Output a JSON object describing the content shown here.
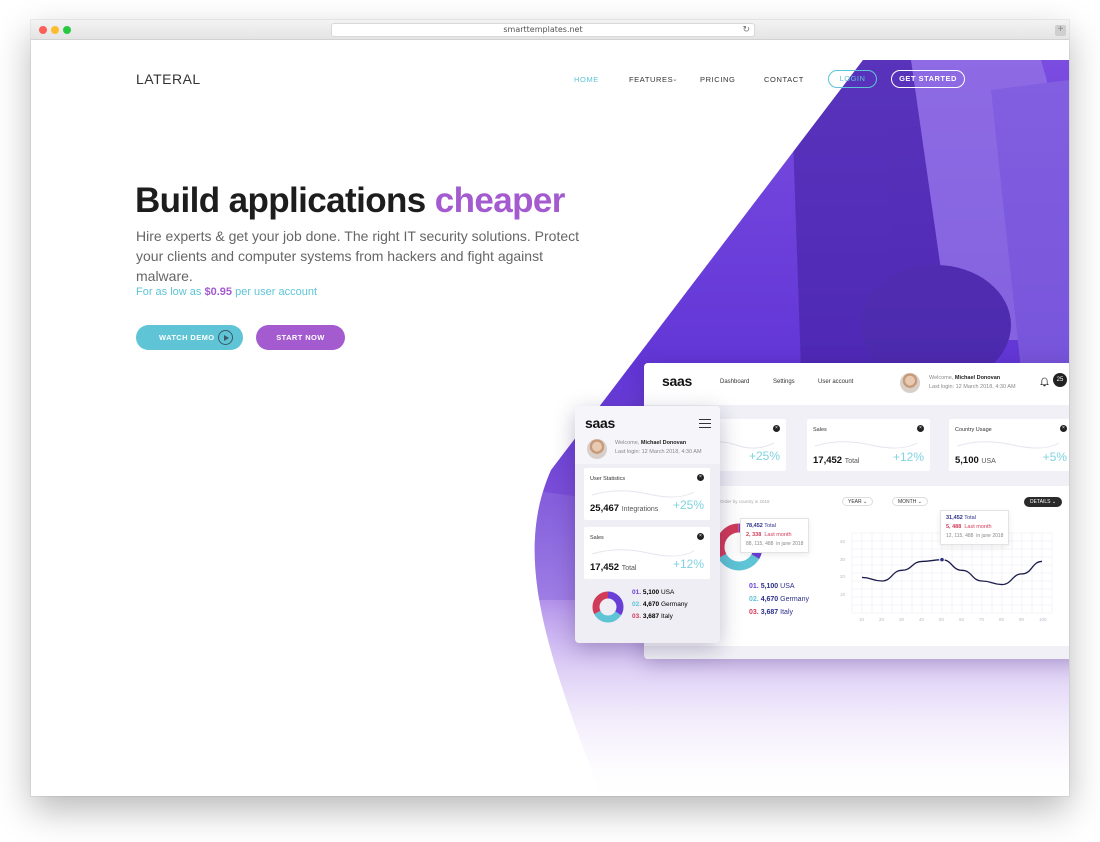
{
  "browser": {
    "url": "smarttemplates.net"
  },
  "nav": {
    "logo": "LATERAL",
    "items": [
      "HOME",
      "FEATURES",
      "PRICING",
      "CONTACT"
    ],
    "login": "LOGIN",
    "get_started": "GET STARTED"
  },
  "hero": {
    "headline": "Build applications",
    "headline_accent": "cheaper",
    "subtitle": "Hire experts & get your job done. The right IT security solutions. Protect your clients and computer systems from hackers and fight against malware.",
    "price_prefix": "For as low as",
    "price": "$0.95",
    "price_suffix": "per user account",
    "watch_demo": "WATCH DEMO",
    "start_now": "START NOW"
  },
  "colors": {
    "accent_purple": "#a35bcf",
    "accent_cyan": "#5ec4d6",
    "hero_purple": "#6a3fd6"
  },
  "dashboard": {
    "logo": "saas",
    "nav": [
      "Dashboard",
      "Settings",
      "User account"
    ],
    "welcome_prefix": "Welcome,",
    "user": "Michael Donovan",
    "last_login": "Last login: 12 March 2018, 4:30 AM",
    "notifications": "25",
    "cards": [
      {
        "title": "",
        "value": "",
        "unit": "ions",
        "change": "+25%"
      },
      {
        "title": "Sales",
        "value": "17,452",
        "unit": "Total",
        "change": "+12%"
      },
      {
        "title": "Country Usage",
        "value": "5,100",
        "unit": "USA",
        "change": "+5%"
      }
    ],
    "panel_caption": "Order by country in 2018",
    "filter_year": "YEAR",
    "filter_month": "MONTH",
    "details": "DETAILS",
    "donut_tooltip": {
      "total": "78,452",
      "total_label": "Total",
      "last": "2, 338",
      "last_label": "Last month",
      "june": "88, 115, 488",
      "june_label": "in june 2018"
    },
    "line_tooltip": {
      "total": "31,452",
      "total_label": "Total",
      "last": "5, 488",
      "last_label": "Last month",
      "june": "12, 115, 488",
      "june_label": "in june 2018"
    },
    "countries": [
      {
        "rank": "01.",
        "value": "5,100",
        "name": "USA"
      },
      {
        "rank": "02.",
        "value": "4,670",
        "name": "Germany"
      },
      {
        "rank": "03.",
        "value": "3,687",
        "name": "Italy"
      }
    ]
  },
  "mobile": {
    "logo": "saas",
    "welcome_prefix": "Welcome,",
    "user": "Michael Donovan",
    "last_login": "Last login: 12 March 2018, 4:30 AM",
    "cards": [
      {
        "title": "User Statistics",
        "value": "25,467",
        "unit": "Integrations",
        "change": "+25%"
      },
      {
        "title": "Sales",
        "value": "17,452",
        "unit": "Total",
        "change": "+12%"
      }
    ],
    "countries": [
      {
        "rank": "01.",
        "value": "5,100",
        "name": "USA"
      },
      {
        "rank": "02.",
        "value": "4,670",
        "name": "Germany"
      },
      {
        "rank": "03.",
        "value": "3,687",
        "name": "Italy"
      }
    ]
  },
  "chart_data": {
    "type": "line",
    "title": "",
    "xlabel": "",
    "ylabel": "",
    "x": [
      10,
      20,
      30,
      40,
      50,
      60,
      70,
      80,
      90,
      100
    ],
    "y_ticks": [
      10,
      20,
      30,
      40
    ],
    "ylim": [
      0,
      45
    ],
    "series": [
      {
        "values": [
          20,
          18,
          24,
          29,
          30,
          24,
          18,
          16,
          22,
          29
        ]
      }
    ],
    "grid": true
  }
}
